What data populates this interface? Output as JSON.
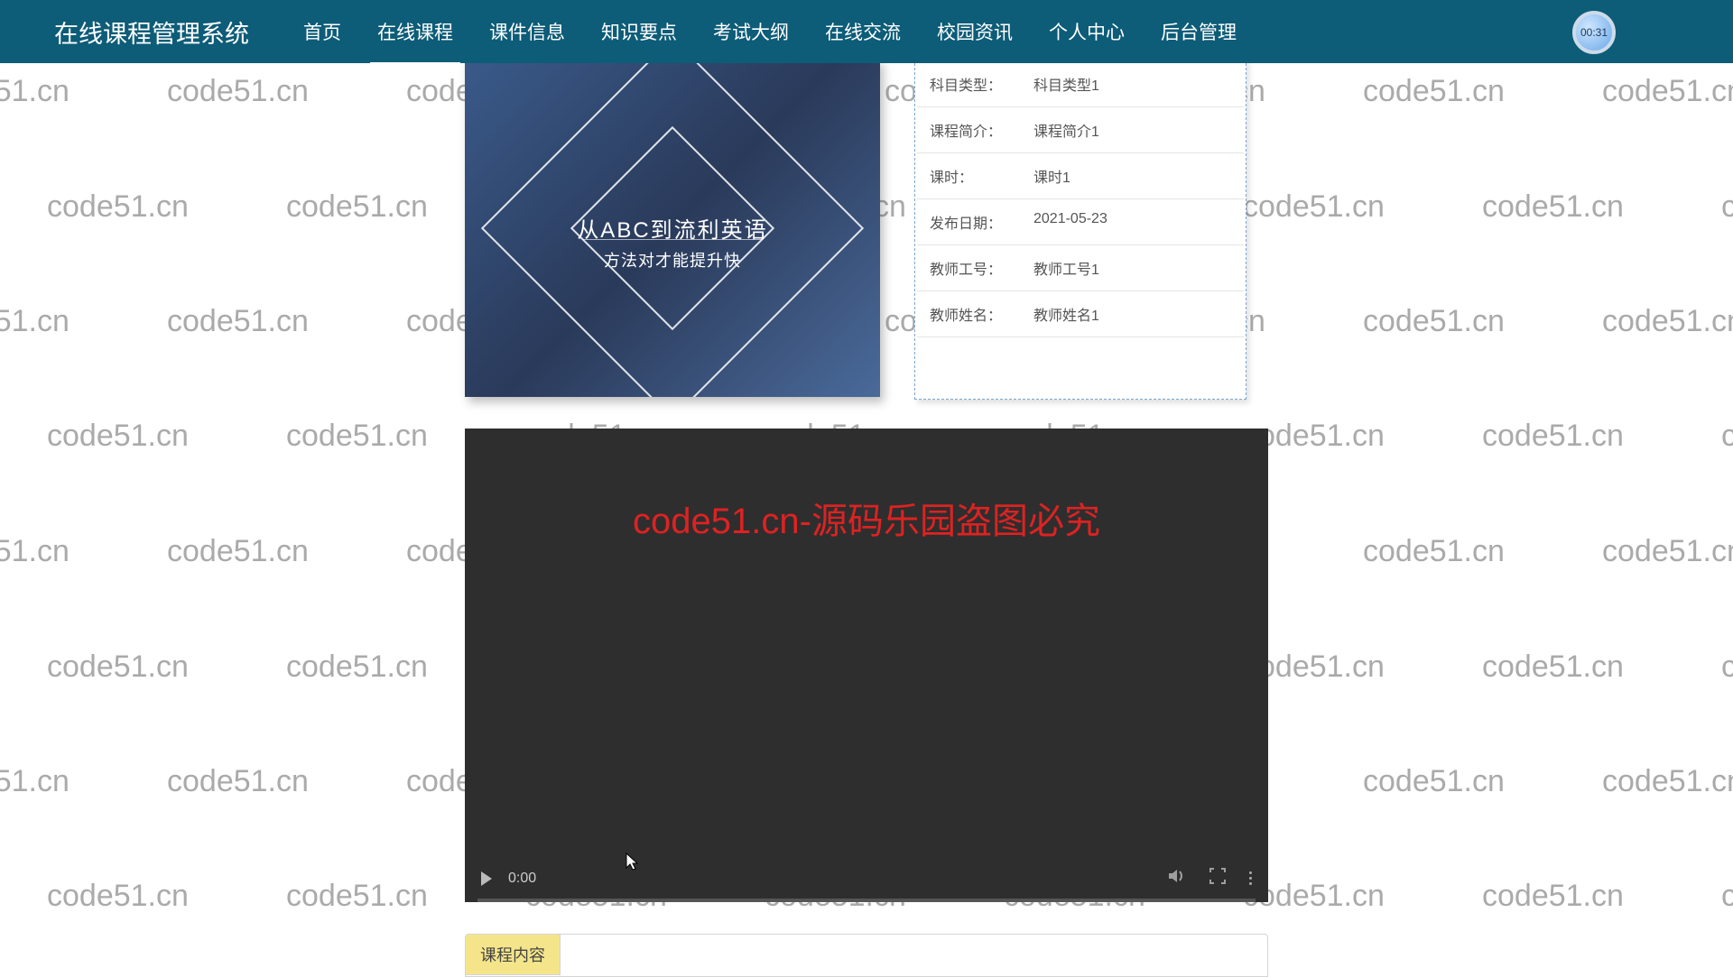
{
  "header": {
    "title": "在线课程管理系统",
    "timer": "00:31"
  },
  "nav": [
    {
      "label": "首页",
      "active": false
    },
    {
      "label": "在线课程",
      "active": true
    },
    {
      "label": "课件信息",
      "active": false
    },
    {
      "label": "知识要点",
      "active": false
    },
    {
      "label": "考试大纲",
      "active": false
    },
    {
      "label": "在线交流",
      "active": false
    },
    {
      "label": "校园资讯",
      "active": false
    },
    {
      "label": "个人中心",
      "active": false
    },
    {
      "label": "后台管理",
      "active": false
    }
  ],
  "course_image": {
    "line1": "从ABC到流利英语",
    "line2": "方法对才能提升快"
  },
  "info_rows": [
    {
      "label": "科目类型：",
      "value": "科目类型1"
    },
    {
      "label": "课程简介：",
      "value": "课程简介1"
    },
    {
      "label": "课时：",
      "value": "课时1"
    },
    {
      "label": "发布日期：",
      "value": "2021-05-23"
    },
    {
      "label": "教师工号：",
      "value": "教师工号1"
    },
    {
      "label": "教师姓名：",
      "value": "教师姓名1"
    }
  ],
  "video": {
    "time": "0:00"
  },
  "content_tab": "课程内容",
  "watermark": "code51.cn",
  "overlay_text": "code51.cn-源码乐园盗图必究"
}
